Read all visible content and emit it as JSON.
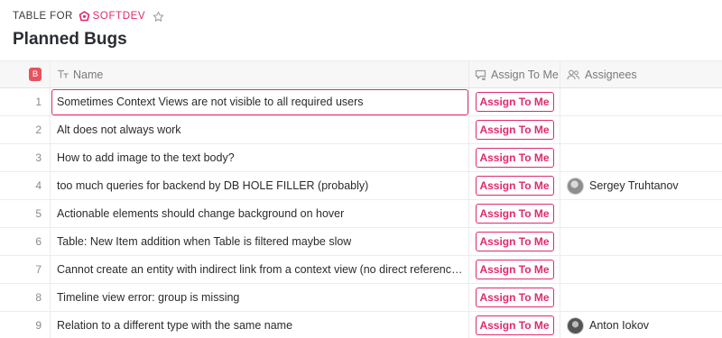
{
  "header": {
    "table_for": "TABLE FOR",
    "brand": "SOFTDEV",
    "title": "Planned Bugs"
  },
  "columns": {
    "badge": "B",
    "name": "Name",
    "assign": "Assign To Me",
    "assignees": "Assignees"
  },
  "rows": [
    {
      "num": "1",
      "name": "Sometimes Context Views are not visible to all required users",
      "button": "Assign To Me",
      "assignee": ""
    },
    {
      "num": "2",
      "name": "Alt does not always work",
      "button": "Assign To Me",
      "assignee": ""
    },
    {
      "num": "3",
      "name": "How to add image to the text body?",
      "button": "Assign To Me",
      "assignee": ""
    },
    {
      "num": "4",
      "name": "too much queries for backend by DB HOLE FILLER (probably)",
      "button": "Assign To Me",
      "assignee": "Sergey Truhtanov"
    },
    {
      "num": "5",
      "name": "Actionable elements should change background on hover",
      "button": "Assign To Me",
      "assignee": ""
    },
    {
      "num": "6",
      "name": "Table: New Item addition when Table is filtered maybe slow",
      "button": "Assign To Me",
      "assignee": ""
    },
    {
      "num": "7",
      "name": "Cannot create an entity with indirect link from a context view (no direct references fo...",
      "button": "Assign To Me",
      "assignee": ""
    },
    {
      "num": "8",
      "name": "Timeline view error: group is missing",
      "button": "Assign To Me",
      "assignee": ""
    },
    {
      "num": "9",
      "name": "Relation to a different type with the same name",
      "button": "Assign To Me",
      "assignee": "Anton Iokov"
    }
  ],
  "colors": {
    "accent": "#e0296f",
    "badge": "#e8525c"
  },
  "icons": {
    "brand": "softdev-logo-icon",
    "star": "star-icon",
    "name_col": "text-type-icon",
    "assign_col": "comment-arrow-icon",
    "assignees_col": "people-icon"
  }
}
